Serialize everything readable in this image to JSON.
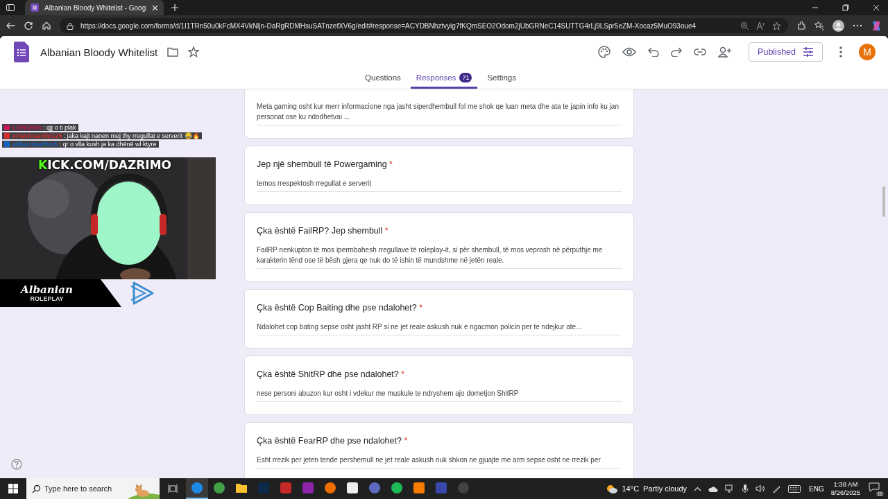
{
  "browser": {
    "tab_title": "Albanian Bloody Whitelist - Goog",
    "url": "https://docs.google.com/forms/d/1I1TRn50u0kFcMX4VkNljn-DaRgRDMHsuSATnzefXV6g/edit#response=ACYDBNhztvyig7fKQmSEO2Odom2jUbGRNeC14SUTTG4rLj9LSpr5eZM-Xocaz5MuO93oue4"
  },
  "form": {
    "title": "Albanian Bloody Whitelist",
    "publish_label": "Published",
    "avatar_initial": "M",
    "tabs": [
      {
        "label": "Questions",
        "selected": false
      },
      {
        "label": "Responses",
        "selected": true,
        "badge": "71"
      },
      {
        "label": "Settings",
        "selected": false
      }
    ]
  },
  "questions": [
    {
      "answer": "Meta gaming osht kur merr informacione nga jasht siperdhembull fol me shok qe luan meta dhe ata te japin info ku jan personat ose ku ndodhetvai ..."
    },
    {
      "title": "Jep një shembull të Powergaming",
      "required_mark": "*",
      "answer": "temos rrespektosh rregullat e serverit"
    },
    {
      "title": "Çka është FailRP? Jep shembull",
      "required_mark": "*",
      "answer": "FailRP nenkupton të mos ipermbahesh rregullave të roleplay-it, si për shembull, të mos veprosh në përputhje me karakterin tënd ose të bësh gjera qe nuk do të ishin të mundshme në jetën reale."
    },
    {
      "title": "Çka është Cop Baiting dhe pse ndalohet?",
      "required_mark": "*",
      "answer": "Ndalohet cop bating sepse osht jasht RP si ne jet reale askush nuk e ngacmon policin per te ndejkur ate..."
    },
    {
      "title": "Çka është ShitRP dhe pse ndalohet?",
      "required_mark": "*",
      "answer": "nese personi abuzon kur osht i vdekur me muskule te ndryshem ajo dometjon ShitRP"
    },
    {
      "title": "Çka është FearRP dhe pse ndalohet?",
      "required_mark": "*",
      "answer": "Esht rrezik per jeten tende pershemull  ne jet reale askush nuk shkon ne gjuajte me arm sepse osht ne rrezik per"
    }
  ],
  "overlay": {
    "chat": [
      {
        "user": "LONCH3s",
        "color": "#c2185b",
        "message": ": qjj o ti plak"
      },
      {
        "user": "erlanbrasniqi125",
        "color": "#d32f2f",
        "message": ": jaka kajt nanen mej thy rregullat e serverit 😂🔥"
      },
      {
        "user": "akkazowarfordi",
        "color": "#1565c0",
        "message": ": qr o vlla kush ja ka dhënë wl ktyre"
      }
    ],
    "channel": "KICK.COM/DAZRIMO",
    "logo_script": "Albanian",
    "logo_sub": "ROLEPLAY"
  },
  "taskbar": {
    "search_placeholder": "Type here to search",
    "apps": [
      {
        "kind": "circle",
        "color": "#1e88e5",
        "selected": true
      },
      {
        "kind": "circle",
        "color": "#43a047",
        "selected": false
      },
      {
        "kind": "folder",
        "color": "#fbc02d",
        "selected": false
      },
      {
        "kind": "square",
        "color": "#0d2a4a",
        "selected": false
      },
      {
        "kind": "square",
        "color": "#c62828",
        "selected": false
      },
      {
        "kind": "square",
        "color": "#8e24aa",
        "selected": false
      },
      {
        "kind": "circle",
        "color": "#ef6c00",
        "selected": false
      },
      {
        "kind": "square",
        "color": "#eeeeee",
        "selected": false
      },
      {
        "kind": "circle",
        "color": "#5c6bc0",
        "selected": false
      },
      {
        "kind": "circle",
        "color": "#1db954",
        "selected": false
      },
      {
        "kind": "square",
        "color": "#f57c00",
        "selected": false
      },
      {
        "kind": "square",
        "color": "#3949ab",
        "selected": false
      },
      {
        "kind": "circle",
        "color": "#424242",
        "selected": false
      }
    ],
    "temperature": "14°C",
    "weather": "Partly cloudy",
    "language": "ENG",
    "time": "1:38 AM",
    "date": "8/26/2025",
    "notifications": "11"
  }
}
